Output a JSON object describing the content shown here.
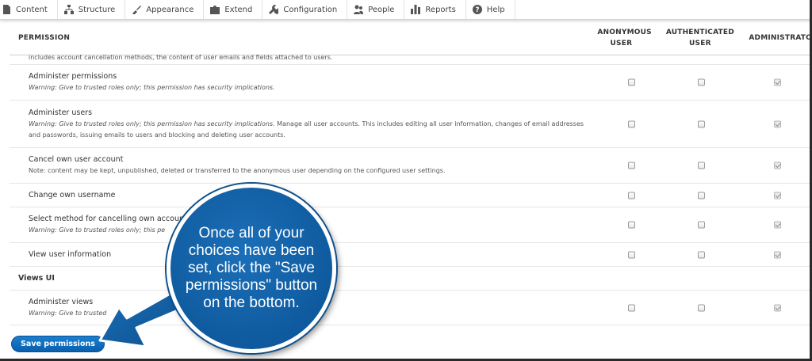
{
  "toolbar": {
    "items": [
      {
        "label": "Content",
        "icon": "page-icon"
      },
      {
        "label": "Structure",
        "icon": "sitemap-icon"
      },
      {
        "label": "Appearance",
        "icon": "brush-icon"
      },
      {
        "label": "Extend",
        "icon": "puzzle-icon"
      },
      {
        "label": "Configuration",
        "icon": "wrench-icon"
      },
      {
        "label": "People",
        "icon": "people-icon"
      },
      {
        "label": "Reports",
        "icon": "bar-chart-icon"
      },
      {
        "label": "Help",
        "icon": "help-icon"
      }
    ]
  },
  "table": {
    "headers": {
      "permission": "PERMISSION",
      "anonymous": "ANONYMOUS USER",
      "authenticated": "AUTHENTICATED USER",
      "administrator": "ADMINISTRATO"
    },
    "truncated_top_text": "includes account cancellation methods, the content of user emails and fields attached to users.",
    "rows": [
      {
        "title": "Administer permissions",
        "warning": "Warning: Give to trusted roles only; this permission has security implications.",
        "description": "",
        "anonymous": false,
        "authenticated": false,
        "administrator": true
      },
      {
        "title": "Administer users",
        "warning": "Warning: Give to trusted roles only; this permission has security implications.",
        "description": " Manage all user accounts. This includes editing all user information, changes of email addresses and passwords, issuing emails to users and blocking and deleting user accounts.",
        "anonymous": false,
        "authenticated": false,
        "administrator": true
      },
      {
        "title": "Cancel own user account",
        "warning": "",
        "description": "Note: content may be kept, unpublished, deleted or transferred to the anonymous user depending on the configured user settings.",
        "anonymous": false,
        "authenticated": false,
        "administrator": true
      },
      {
        "title": "Change own username",
        "warning": "",
        "description": "",
        "anonymous": false,
        "authenticated": false,
        "administrator": true
      },
      {
        "title": "Select method for cancelling own account",
        "warning": "Warning: Give to trusted roles only; this pe",
        "description": "",
        "anonymous": false,
        "authenticated": false,
        "administrator": true
      },
      {
        "title": "View user information",
        "warning": "",
        "description": "",
        "anonymous": false,
        "authenticated": false,
        "administrator": true
      }
    ],
    "section": "Views UI",
    "views_row": {
      "title": "Administer views",
      "warning": "Warning: Give to trusted",
      "anonymous": false,
      "authenticated": false,
      "administrator": true
    }
  },
  "save_button": "Save permissions",
  "callout": {
    "text": "Once all of your choices have been set, click the \"Save permissions\" button on the bottom."
  },
  "colors": {
    "button_blue": "#0a5fad",
    "callout_blue": "#0f5a9e",
    "arrow_blue": "#0f5a9e"
  }
}
